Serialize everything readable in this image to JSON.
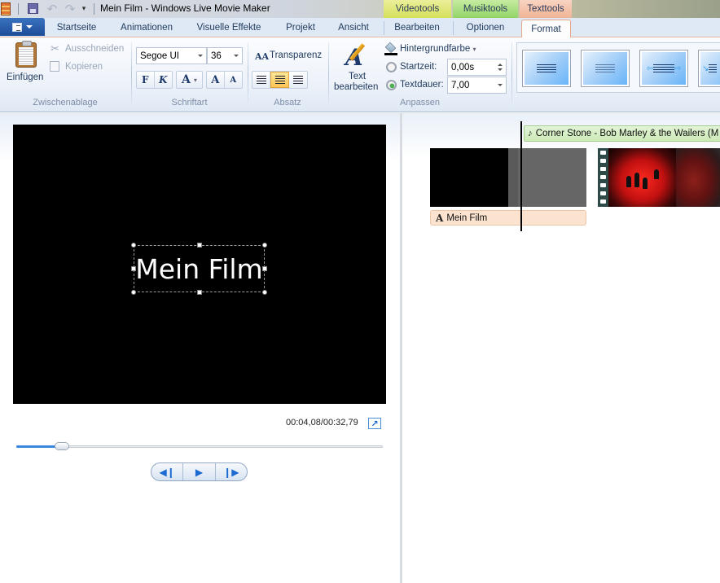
{
  "window": {
    "title": "Mein Film - Windows Live Movie Maker",
    "quick_access": [
      "app-icon",
      "save-icon",
      "undo-icon",
      "redo-icon",
      "customize-icon"
    ]
  },
  "context_tabs": {
    "video": "Videotools",
    "music": "Musiktools",
    "text": "Texttools"
  },
  "ribbon_tabs": {
    "startseite": "Startseite",
    "animationen": "Animationen",
    "visuelle_effekte": "Visuelle Effekte",
    "projekt": "Projekt",
    "ansicht": "Ansicht",
    "bearbeiten": "Bearbeiten",
    "optionen": "Optionen",
    "format": "Format",
    "active": "Format"
  },
  "ribbon": {
    "clipboard": {
      "label": "Zwischenablage",
      "paste": "Einfügen",
      "cut": "Ausschneiden",
      "copy": "Kopieren"
    },
    "font": {
      "label": "Schriftart",
      "family": "Segoe UI",
      "size": "36",
      "bold": "F",
      "italic": "K",
      "color": "A",
      "grow": "A",
      "shrink": "A"
    },
    "paragraph": {
      "label": "Absatz",
      "transparency": "Transparenz",
      "active_alignment": "center"
    },
    "adjust": {
      "label": "Anpassen",
      "edit_text_line1": "Text",
      "edit_text_line2": "bearbeiten",
      "background_color": "Hintergrundfarbe",
      "start_time_label": "Startzeit:",
      "start_time_value": "0,00s",
      "duration_label": "Textdauer:",
      "duration_value": "7,00"
    },
    "effects_gallery": [
      "effect-none",
      "effect-fade",
      "effect-fly-in-out",
      "effect-swirl"
    ]
  },
  "preview": {
    "caption": "Mein Film",
    "timecode": "00:04,08/00:32,79",
    "position_fraction": 0.1244,
    "controls": {
      "previous": "previous-frame",
      "play": "play",
      "next": "next-frame"
    }
  },
  "storyboard": {
    "music_track": "Corner Stone - Bob Marley & the Wailers (M",
    "text_clip": "Mein Film"
  },
  "colors": {
    "accent": "#1a6ad0",
    "format_tab_border": "#e6a88c",
    "text_clip_bg": "#fbe3cf",
    "music_bar_bg": "#cdeab8"
  }
}
